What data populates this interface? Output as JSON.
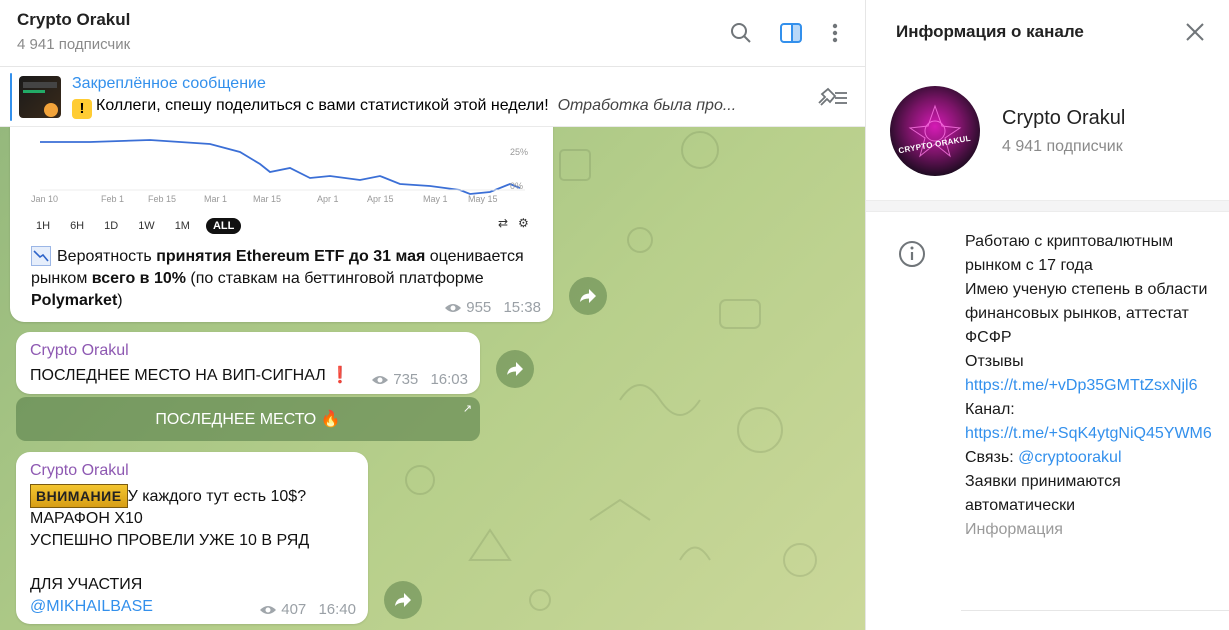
{
  "header": {
    "title": "Crypto Orakul",
    "subtitle": "4 941 подписчик"
  },
  "pinned": {
    "title": "Закреплённое сообщение",
    "text": "Коллеги, спешу поделиться с вами статистикой этой недели!",
    "text_italic": "Отработка была про..."
  },
  "messages": [
    {
      "chart": {
        "x_ticks": [
          "Jan 10",
          "Feb 1",
          "Feb 15",
          "Mar 1",
          "Mar 15",
          "Apr 1",
          "Apr 15",
          "May 1",
          "May 15"
        ],
        "y_ticks": [
          "25%",
          "0%"
        ],
        "ranges": [
          "1H",
          "6H",
          "1D",
          "1W",
          "1M",
          "ALL"
        ],
        "active_range": "ALL"
      },
      "text_parts": [
        "Вероятность ",
        "принятия Ethereum ETF до 31 мая",
        " оценивается рынком ",
        "всего в 10%",
        " (по ставкам на беттинговой платформе ",
        "Polymarket",
        ")"
      ],
      "views": "955",
      "time": "15:38"
    },
    {
      "author": "Crypto Orakul",
      "text": "ПОСЛЕДНЕЕ МЕСТО НА ВИП-СИГНАЛ",
      "emoji": "❗",
      "views": "735",
      "time": "16:03",
      "button": "ПОСЛЕДНЕЕ МЕСТО 🔥"
    },
    {
      "author": "Crypto Orakul",
      "badge": "ВНИМАНИЕ",
      "line1": "У каждого тут есть 10$?",
      "line2": "МАРАФОН Х10",
      "line3": "УСПЕШНО ПРОВЕЛИ УЖЕ 10 В РЯД",
      "line4": "ДЛЯ УЧАСТИЯ",
      "link": "@MIKHAILBASE",
      "views": "407",
      "time": "16:40"
    }
  ],
  "info": {
    "heading": "Информация о канале",
    "name": "Crypto Orakul",
    "subscribers": "4 941 подписчик",
    "avatar_text": "CRYPTO ORAKUL",
    "about_lines": [
      "Работаю с криптовалютным рынком с 17 года",
      "Имею ученую степень в области финансовых рынков, аттестат ФСФР",
      "Отзывы"
    ],
    "link1": "https://t.me/+vDp35GMTtZsxNjl6",
    "channel_label": "Канал:",
    "link2": "https://t.me/+SqK4ytgNiQ45YWM6",
    "contact_label": "Связь: ",
    "contact": "@cryptoorakul",
    "requests": "Заявки принимаются автоматически",
    "section_label": "Информация"
  }
}
